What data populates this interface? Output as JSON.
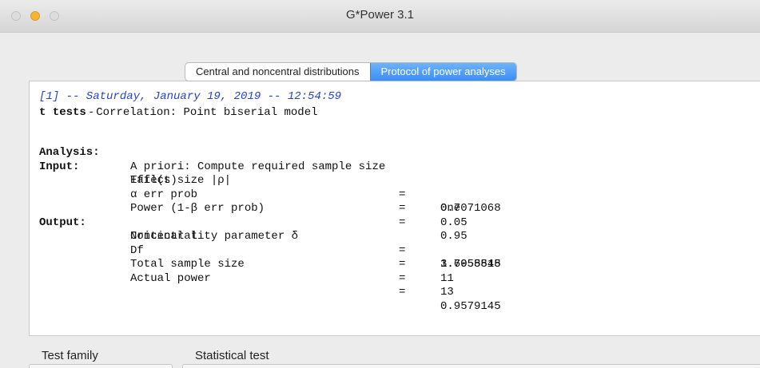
{
  "window": {
    "title": "G*Power 3.1"
  },
  "tabs": [
    {
      "label": "Central and noncentral distributions",
      "active": false
    },
    {
      "label": "Protocol of power analyses",
      "active": true
    }
  ],
  "protocol": {
    "header": "[1] -- Saturday, January 19, 2019 -- 12:54:59",
    "test_family": "t tests",
    "test_sep": " - ",
    "test_name": "Correlation: Point biserial model",
    "analysis_label": "Analysis:",
    "analysis_value": "A priori: Compute required sample size",
    "input_label": "Input:",
    "inputs": [
      {
        "name": "Tail(s)",
        "eq": "=",
        "value": "One"
      },
      {
        "name": "Effect size |ρ|",
        "eq": "=",
        "value": "0.7071068"
      },
      {
        "name": "α err prob",
        "eq": "=",
        "value": "0.05"
      },
      {
        "name": "Power (1-β err prob)",
        "eq": "=",
        "value": "0.95"
      }
    ],
    "output_label": "Output:",
    "outputs": [
      {
        "name": "Noncentrality parameter δ",
        "eq": "=",
        "value": "3.6055515"
      },
      {
        "name": "Critical t",
        "eq": "=",
        "value": "1.7958848"
      },
      {
        "name": "Df",
        "eq": "=",
        "value": "11"
      },
      {
        "name": "Total sample size",
        "eq": "=",
        "value": "13"
      },
      {
        "name": "Actual power",
        "eq": "=",
        "value": "0.9579145"
      }
    ]
  },
  "footer": {
    "test_family_label": "Test family",
    "statistical_test_label": "Statistical test"
  }
}
